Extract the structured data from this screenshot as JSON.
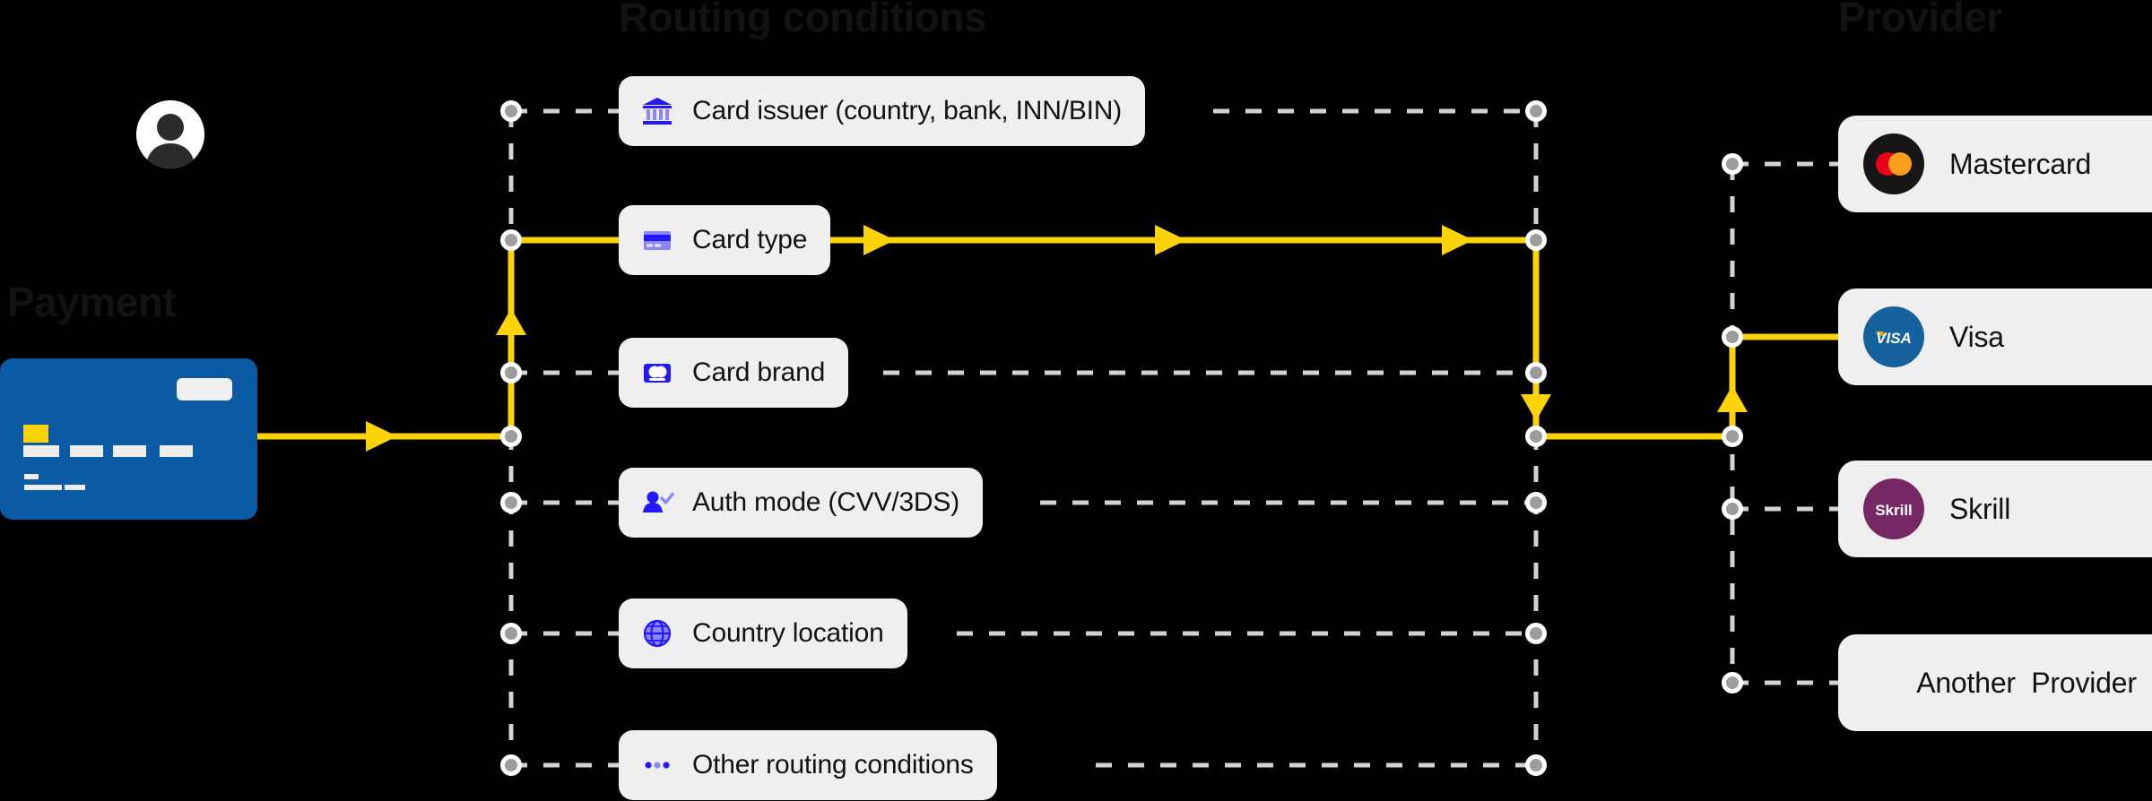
{
  "background_color": "#000000",
  "accent_color": "#fcd307",
  "card_bg_color": "#efefef",
  "dashed_line_color": "#d2d2d2",
  "sections": {
    "payment": {
      "title": "Payment"
    },
    "routing": {
      "title": "Routing conditions"
    },
    "provider": {
      "title": "Provider"
    }
  },
  "payment_card": {
    "name": "credit-card-illustration",
    "color": "#0a5ba4",
    "accent_square_color": "#fcd307",
    "avatar": "person-avatar"
  },
  "routing_conditions": [
    {
      "label": "Card issuer (country, bank, INN/BIN)",
      "icon": "bank-icon",
      "active": false
    },
    {
      "label": "Card type",
      "icon": "card-type-icon",
      "active": true
    },
    {
      "label": "Card brand",
      "icon": "card-brand-icon",
      "active": false
    },
    {
      "label": "Auth mode (CVV/3DS)",
      "icon": "auth-user-icon",
      "active": false
    },
    {
      "label": "Country location",
      "icon": "globe-icon",
      "active": false
    },
    {
      "label": "Other routing conditions",
      "icon": "ellipsis-icon",
      "active": false
    }
  ],
  "providers": [
    {
      "label": "Mastercard",
      "logo": "mastercard-logo",
      "active": false
    },
    {
      "label": "Visa",
      "logo": "visa-logo",
      "active": true
    },
    {
      "label": "Skrill",
      "logo": "skrill-logo",
      "active": false
    },
    {
      "label": "Another  Provider",
      "logo": null,
      "active": false
    }
  ],
  "logo_colors": {
    "mastercard_circle": "#161616",
    "mastercard_red": "#eb001b",
    "mastercard_orange": "#f79e1b",
    "visa_circle": "#15629f",
    "visa_swoosh": "#f2a900",
    "skrill_circle": "#752864"
  },
  "flow": {
    "description": "active-route",
    "arrow_color": "#fcd307",
    "path": [
      "Payment",
      "Card type",
      "Visa"
    ]
  }
}
